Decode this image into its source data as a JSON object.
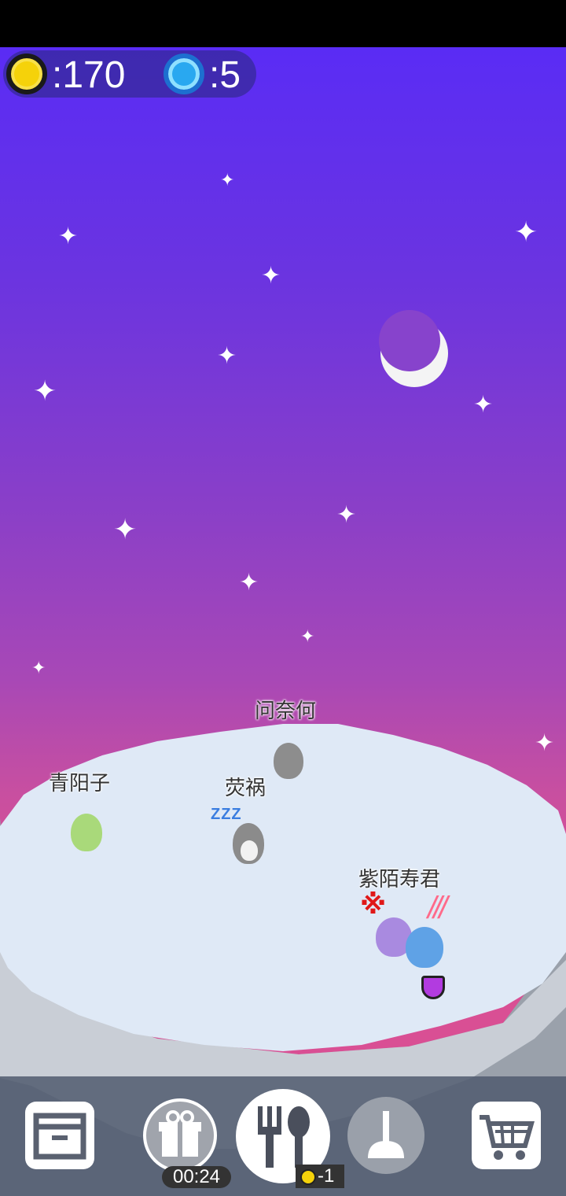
{
  "currency": {
    "coins": ":170",
    "gems": ":5"
  },
  "pets": [
    {
      "name": "问奈何"
    },
    {
      "name": "青阳子"
    },
    {
      "name": "荧祸",
      "status": "ZZZ"
    },
    {
      "name": "紫陌寿君"
    }
  ],
  "toolbar": {
    "gift_timer": "00:24",
    "feed_cost": "-1"
  },
  "colors": {
    "coin": "#f5d20a",
    "gem": "#29a8f0",
    "island": "#dfe9f6"
  }
}
